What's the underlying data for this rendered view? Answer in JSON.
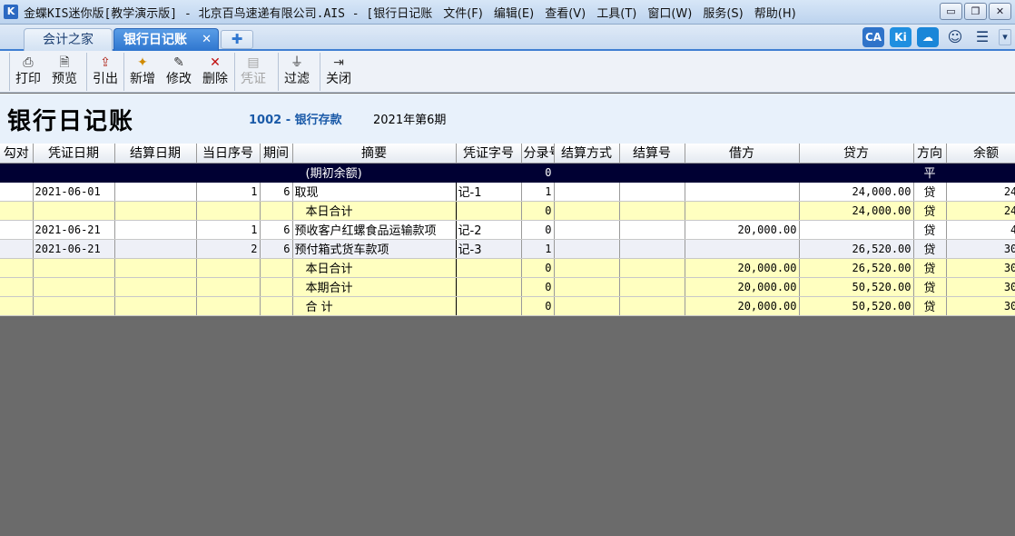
{
  "window": {
    "title": "金蝶KIS迷你版[教学演示版] - 北京百鸟速递有限公司.AIS - [银行日记账",
    "menu": [
      "文件(F)",
      "编辑(E)",
      "查看(V)",
      "工具(T)",
      "窗口(W)",
      "服务(S)",
      "帮助(H)"
    ],
    "controls": {
      "minimize": "▭",
      "restore": "❐",
      "close": "✕"
    }
  },
  "tabs": {
    "items": [
      {
        "label": "会计之家",
        "active": false
      },
      {
        "label": "银行日记账",
        "active": true
      }
    ],
    "close_glyph": "✕",
    "add_glyph": "✚"
  },
  "top_icons": [
    {
      "name": "link-icon",
      "glyph": "CA"
    },
    {
      "name": "kis-icon",
      "glyph": "Ki"
    },
    {
      "name": "cloud-icon",
      "glyph": "☁"
    },
    {
      "name": "smiley-icon",
      "glyph": "☺"
    },
    {
      "name": "message-icon",
      "glyph": "☰"
    },
    {
      "name": "dropdown-icon",
      "glyph": "▾"
    }
  ],
  "toolbar": {
    "print": {
      "label": "打印",
      "icon": "printer-icon",
      "glyph": "⎙"
    },
    "preview": {
      "label": "预览",
      "icon": "preview-icon",
      "glyph": "🗎"
    },
    "export": {
      "label": "引出",
      "icon": "export-icon",
      "glyph": "⇪"
    },
    "add": {
      "label": "新增",
      "icon": "new-icon",
      "glyph": "✦"
    },
    "edit": {
      "label": "修改",
      "icon": "edit-icon",
      "glyph": "✎"
    },
    "delete": {
      "label": "删除",
      "icon": "delete-icon",
      "glyph": "✕"
    },
    "voucher": {
      "label": "凭证",
      "icon": "voucher-icon",
      "glyph": "▤"
    },
    "filter": {
      "label": "过滤",
      "icon": "filter-icon",
      "glyph": "⏚"
    },
    "close": {
      "label": "关闭",
      "icon": "exit-icon",
      "glyph": "⇥"
    }
  },
  "heading": {
    "title": "银行日记账",
    "account": "1002 - 银行存款",
    "period": "2021年第6期"
  },
  "table": {
    "columns": [
      "勾对",
      "凭证日期",
      "结算日期",
      "当日序号",
      "期间",
      "摘要",
      "凭证字号",
      "分录号",
      "结算方式",
      "结算号",
      "借方",
      "贷方",
      "方向",
      "余额"
    ],
    "rows": [
      {
        "type": "open",
        "cells": [
          "",
          "",
          "",
          "",
          "",
          "(期初余额)",
          "",
          "0",
          "",
          "",
          "",
          "",
          "平",
          ""
        ]
      },
      {
        "type": "detail",
        "cells": [
          "",
          "2021-06-01",
          "",
          "1",
          "6",
          "取现",
          "记-1",
          "1",
          "",
          "",
          "",
          "24,000.00",
          "贷",
          "24,"
        ]
      },
      {
        "type": "sum",
        "cells": [
          "",
          "",
          "",
          "",
          "",
          "本日合计",
          "",
          "0",
          "",
          "",
          "",
          "24,000.00",
          "贷",
          "24,"
        ]
      },
      {
        "type": "detail",
        "cells": [
          "",
          "2021-06-21",
          "",
          "1",
          "6",
          "预收客户红螺食品运输款项",
          "记-2",
          "0",
          "",
          "",
          "20,000.00",
          "",
          "贷",
          "4,"
        ]
      },
      {
        "type": "detail-alt",
        "cells": [
          "",
          "2021-06-21",
          "",
          "2",
          "6",
          "预付箱式货车款项",
          "记-3",
          "1",
          "",
          "",
          "",
          "26,520.00",
          "贷",
          "30,"
        ]
      },
      {
        "type": "sum",
        "cells": [
          "",
          "",
          "",
          "",
          "",
          "本日合计",
          "",
          "0",
          "",
          "",
          "20,000.00",
          "26,520.00",
          "贷",
          "30,"
        ]
      },
      {
        "type": "sum",
        "cells": [
          "",
          "",
          "",
          "",
          "",
          "本期合计",
          "",
          "0",
          "",
          "",
          "20,000.00",
          "50,520.00",
          "贷",
          "30,"
        ]
      },
      {
        "type": "sum",
        "cells": [
          "",
          "",
          "",
          "",
          "",
          "合  计",
          "",
          "0",
          "",
          "",
          "20,000.00",
          "50,520.00",
          "贷",
          "30,"
        ]
      }
    ]
  }
}
